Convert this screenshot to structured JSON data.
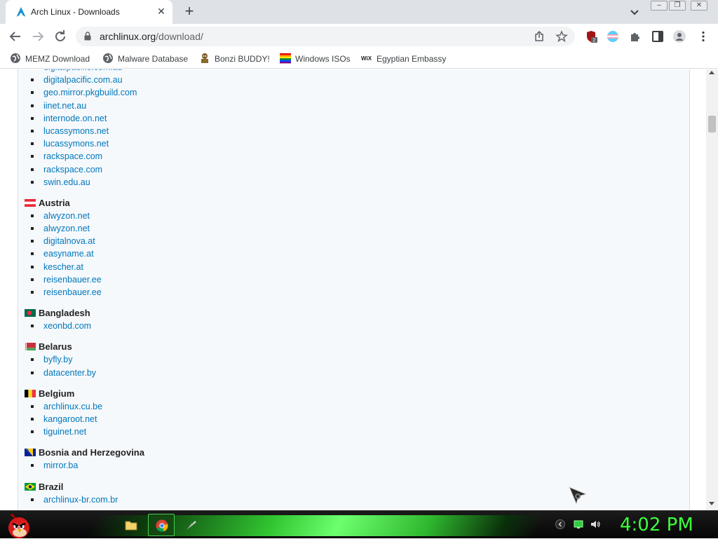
{
  "browser": {
    "tab_title": "Arch Linux - Downloads",
    "tab_close": "✕",
    "new_tab": "+",
    "url_host": "archlinux.org",
    "url_path": "/download/",
    "extension_badge": "2"
  },
  "bookmarks": [
    {
      "label": "MEMZ Download",
      "icon": "globe-icon"
    },
    {
      "label": "Malware Database",
      "icon": "globe-icon"
    },
    {
      "label": "Bonzi BUDDY!",
      "icon": "bonzi-icon"
    },
    {
      "label": "Windows ISOs",
      "icon": "rainbow-flag-icon"
    },
    {
      "label": "Egyptian Embassy",
      "icon": "wix-icon"
    }
  ],
  "mirror_sections": [
    {
      "country": "",
      "mirrors": [
        "digitalpacific.com.au",
        "digitalpacific.com.au",
        "geo.mirror.pkgbuild.com",
        "iinet.net.au",
        "internode.on.net",
        "lucassymons.net",
        "lucassymons.net",
        "rackspace.com",
        "rackspace.com",
        "swin.edu.au"
      ]
    },
    {
      "country": "Austria",
      "flag": "austria",
      "mirrors": [
        "alwyzon.net",
        "alwyzon.net",
        "digitalnova.at",
        "easyname.at",
        "kescher.at",
        "reisenbauer.ee",
        "reisenbauer.ee"
      ]
    },
    {
      "country": "Bangladesh",
      "flag": "bangladesh",
      "mirrors": [
        "xeonbd.com"
      ]
    },
    {
      "country": "Belarus",
      "flag": "belarus",
      "mirrors": [
        "byfly.by",
        "datacenter.by"
      ]
    },
    {
      "country": "Belgium",
      "flag": "belgium",
      "mirrors": [
        "archlinux.cu.be",
        "kangaroot.net",
        "tiguinet.net"
      ]
    },
    {
      "country": "Bosnia and Herzegovina",
      "flag": "bosnia",
      "mirrors": [
        "mirror.ba"
      ]
    },
    {
      "country": "Brazil",
      "flag": "brazil",
      "mirrors": [
        "archlinux-br.com.br"
      ]
    }
  ],
  "taskbar": {
    "clock": "4:02 PM"
  },
  "colors": {
    "link": "#0077bb",
    "page_bg": "#f6f9fc",
    "clock": "#3cff3c"
  }
}
